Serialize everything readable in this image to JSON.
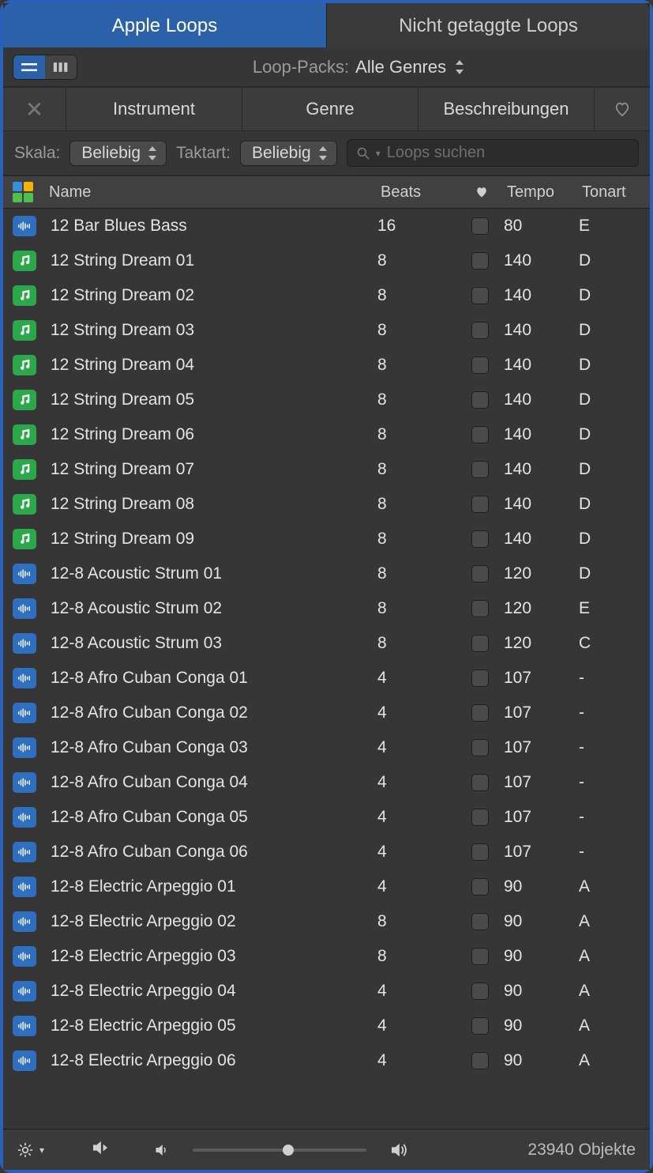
{
  "tabs": {
    "apple_loops": "Apple Loops",
    "untagged": "Nicht getaggte Loops"
  },
  "loop_packs": {
    "label": "Loop-Packs:",
    "value": "Alle Genres"
  },
  "categories": {
    "instrument": "Instrument",
    "genre": "Genre",
    "descriptions": "Beschreibungen"
  },
  "filters": {
    "scale_label": "Skala:",
    "scale_value": "Beliebig",
    "time_label": "Taktart:",
    "time_value": "Beliebig",
    "search_placeholder": "Loops suchen"
  },
  "columns": {
    "name": "Name",
    "beats": "Beats",
    "tempo": "Tempo",
    "key": "Tonart"
  },
  "footer": {
    "count": "23940 Objekte"
  },
  "loops": [
    {
      "type": "audio",
      "name": "12 Bar Blues Bass",
      "beats": "16",
      "tempo": "80",
      "key": "E"
    },
    {
      "type": "midi",
      "name": "12 String Dream 01",
      "beats": "8",
      "tempo": "140",
      "key": "D"
    },
    {
      "type": "midi",
      "name": "12 String Dream 02",
      "beats": "8",
      "tempo": "140",
      "key": "D"
    },
    {
      "type": "midi",
      "name": "12 String Dream 03",
      "beats": "8",
      "tempo": "140",
      "key": "D"
    },
    {
      "type": "midi",
      "name": "12 String Dream 04",
      "beats": "8",
      "tempo": "140",
      "key": "D"
    },
    {
      "type": "midi",
      "name": "12 String Dream 05",
      "beats": "8",
      "tempo": "140",
      "key": "D"
    },
    {
      "type": "midi",
      "name": "12 String Dream 06",
      "beats": "8",
      "tempo": "140",
      "key": "D"
    },
    {
      "type": "midi",
      "name": "12 String Dream 07",
      "beats": "8",
      "tempo": "140",
      "key": "D"
    },
    {
      "type": "midi",
      "name": "12 String Dream 08",
      "beats": "8",
      "tempo": "140",
      "key": "D"
    },
    {
      "type": "midi",
      "name": "12 String Dream 09",
      "beats": "8",
      "tempo": "140",
      "key": "D"
    },
    {
      "type": "audio",
      "name": "12-8 Acoustic Strum 01",
      "beats": "8",
      "tempo": "120",
      "key": "D"
    },
    {
      "type": "audio",
      "name": "12-8 Acoustic Strum 02",
      "beats": "8",
      "tempo": "120",
      "key": "E"
    },
    {
      "type": "audio",
      "name": "12-8 Acoustic Strum 03",
      "beats": "8",
      "tempo": "120",
      "key": "C"
    },
    {
      "type": "audio",
      "name": "12-8 Afro Cuban Conga 01",
      "beats": "4",
      "tempo": "107",
      "key": "-"
    },
    {
      "type": "audio",
      "name": "12-8 Afro Cuban Conga 02",
      "beats": "4",
      "tempo": "107",
      "key": "-"
    },
    {
      "type": "audio",
      "name": "12-8 Afro Cuban Conga 03",
      "beats": "4",
      "tempo": "107",
      "key": "-"
    },
    {
      "type": "audio",
      "name": "12-8 Afro Cuban Conga 04",
      "beats": "4",
      "tempo": "107",
      "key": "-"
    },
    {
      "type": "audio",
      "name": "12-8 Afro Cuban Conga 05",
      "beats": "4",
      "tempo": "107",
      "key": "-"
    },
    {
      "type": "audio",
      "name": "12-8 Afro Cuban Conga 06",
      "beats": "4",
      "tempo": "107",
      "key": "-"
    },
    {
      "type": "audio",
      "name": "12-8 Electric Arpeggio 01",
      "beats": "4",
      "tempo": "90",
      "key": "A"
    },
    {
      "type": "audio",
      "name": "12-8 Electric Arpeggio 02",
      "beats": "8",
      "tempo": "90",
      "key": "A"
    },
    {
      "type": "audio",
      "name": "12-8 Electric Arpeggio 03",
      "beats": "8",
      "tempo": "90",
      "key": "A"
    },
    {
      "type": "audio",
      "name": "12-8 Electric Arpeggio 04",
      "beats": "4",
      "tempo": "90",
      "key": "A"
    },
    {
      "type": "audio",
      "name": "12-8 Electric Arpeggio 05",
      "beats": "4",
      "tempo": "90",
      "key": "A"
    },
    {
      "type": "audio",
      "name": "12-8 Electric Arpeggio 06",
      "beats": "4",
      "tempo": "90",
      "key": "A"
    }
  ]
}
